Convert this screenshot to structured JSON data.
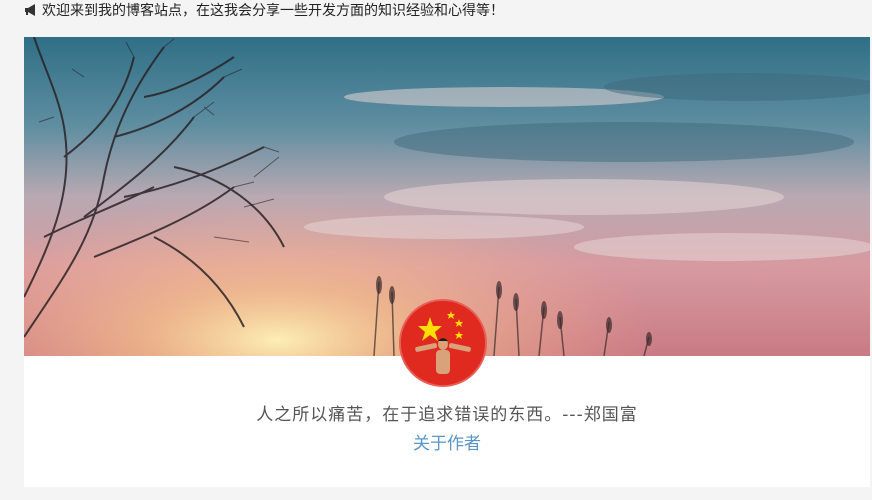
{
  "notice": {
    "icon": "megaphone-icon",
    "text": "欢迎来到我的博客站点，在这我会分享一些开发方面的知识经验和心得等！"
  },
  "profile": {
    "avatar": "avatar-icon",
    "quote": "人之所以痛苦，在于追求错误的东西。---郑国富",
    "about_link": "关于作者"
  },
  "colors": {
    "page_background": "#f4f4f4",
    "card_background": "#ffffff",
    "link": "#5a95c8",
    "quote_text": "#555555",
    "avatar_background": "#e12a1f"
  }
}
